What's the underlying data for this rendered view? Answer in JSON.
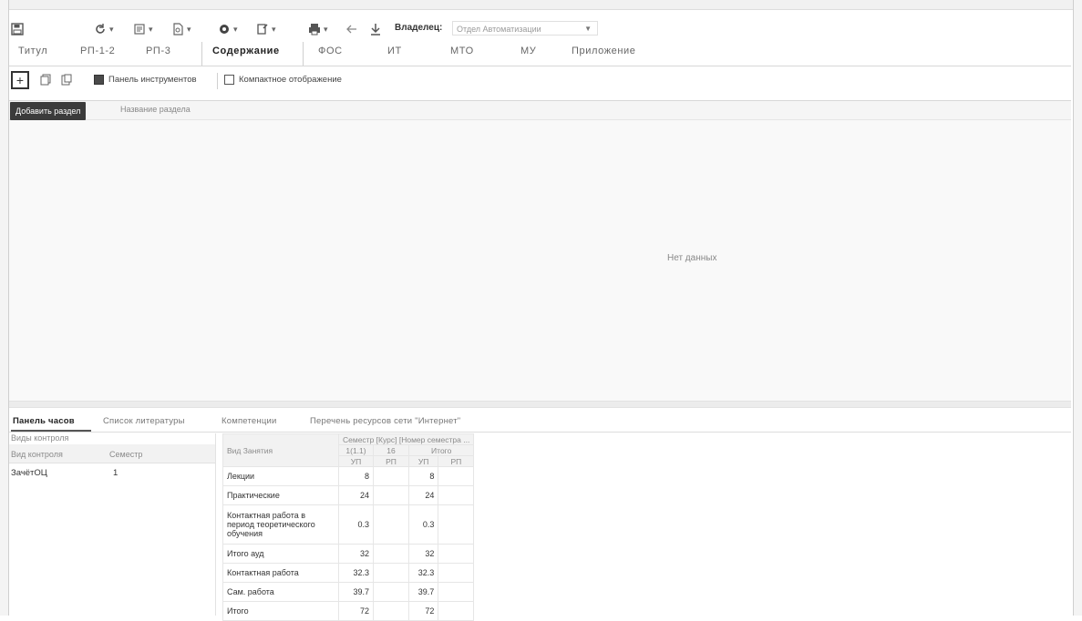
{
  "toolbar": {
    "owner_label": "Владелец:",
    "owner_value": "Отдел Автоматизации",
    "icons": [
      "save-icon",
      "refresh-icon",
      "tools-icon",
      "document-icon",
      "settings-icon",
      "print-icon",
      "import-icon",
      "back-icon",
      "download-icon"
    ]
  },
  "tabs": [
    "Титул",
    "РП-1-2",
    "РП-3",
    "Содержание",
    "ФОС",
    "ИТ",
    "МТО",
    "МУ",
    "Приложение"
  ],
  "active_tab": "Содержание",
  "sub_toolbar": {
    "add_tooltip": "Добавить раздел",
    "toolbar_panel_label": "Панель инструментов",
    "toolbar_panel_checked": true,
    "compact_label": "Компактное отображение",
    "compact_checked": false
  },
  "grid": {
    "column_title": "Название раздела",
    "empty_text": "Нет данных"
  },
  "bottom_tabs": [
    "Панель часов",
    "Список литературы",
    "Компетенции",
    "Перечень ресурсов сети \"Интернет\""
  ],
  "control_panel": {
    "title": "Виды контроля",
    "col_kind": "Вид контроля",
    "col_semester": "Семестр",
    "rows": [
      {
        "kind": "ЗачётОЦ",
        "semester": "1"
      }
    ]
  },
  "hours_table": {
    "header_kind": "Вид Занятия",
    "header_semester": "Семестр [Курс] [Номер семестра ...",
    "semester_group": "1(1.1)",
    "weeks": "16",
    "total": "Итого",
    "sub_up": "УП",
    "sub_rp": "РП",
    "rows": [
      {
        "name": "Лекции",
        "up": "8",
        "total_up": "8"
      },
      {
        "name": "Практические",
        "up": "24",
        "total_up": "24"
      },
      {
        "name": "Контактная работа в период теоретического обучения",
        "up": "0.3",
        "total_up": "0.3"
      },
      {
        "name": "Итого ауд",
        "up": "32",
        "total_up": "32"
      },
      {
        "name": "Контактная работа",
        "up": "32.3",
        "total_up": "32.3"
      },
      {
        "name": "Сам. работа",
        "up": "39.7",
        "total_up": "39.7"
      },
      {
        "name": "Итого",
        "up": "72",
        "total_up": "72"
      }
    ]
  }
}
